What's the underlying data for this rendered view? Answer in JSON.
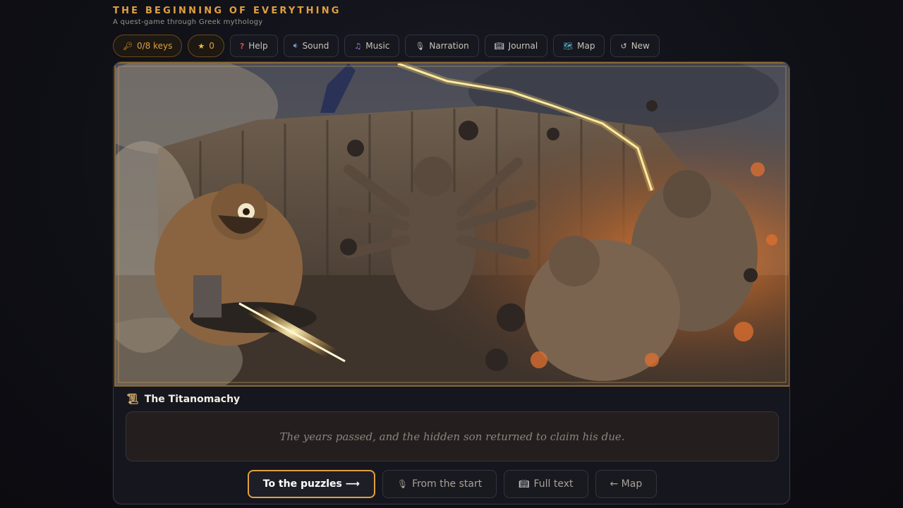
{
  "header": {
    "title": "THE BEGINNING OF EVERYTHING",
    "subtitle": "A quest-game through Greek mythology"
  },
  "toolbar": {
    "keys_label": "0/8 keys",
    "stars_label": "0",
    "help_label": "Help",
    "sound_label": "Sound",
    "music_label": "Music",
    "narration_label": "Narration",
    "journal_label": "Journal",
    "map_label": "Map",
    "new_label": "New"
  },
  "icons": {
    "key": "key-icon",
    "star": "star-icon",
    "help": "question-icon",
    "sound": "speaker-icon",
    "music": "music-note-icon",
    "narration": "microphone-icon",
    "journal": "book-icon",
    "map": "map-icon",
    "new": "refresh-icon",
    "chapter": "scroll-icon"
  },
  "scene": {
    "description_alt": "Cyclops forging a thunderbolt, hundred-handed giants and Titans battling before a cliff under lightning"
  },
  "chapter": {
    "title": "The Titanomachy"
  },
  "narration": {
    "text": "The years passed, and the hidden son returned to claim his due."
  },
  "actions": {
    "puzzles_label": "To the puzzles ⟶",
    "from_start_label": "From the start",
    "full_text_label": "Full text",
    "map_label": "← Map"
  },
  "colors": {
    "accent": "#e0a040",
    "background": "#0f0f16",
    "frame_gold": "#8a6a34"
  }
}
